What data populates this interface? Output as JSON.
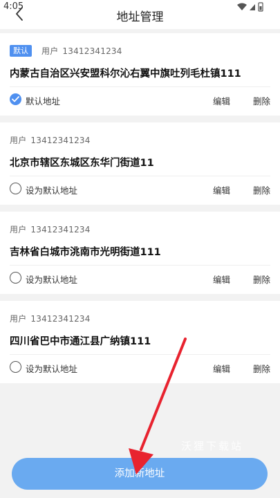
{
  "status": {
    "time": "4:05"
  },
  "header": {
    "title": "地址管理"
  },
  "addresses": [
    {
      "badge": "默认",
      "user_label": "用户",
      "phone": "13412341234",
      "address": "内蒙古自治区兴安盟科尔沁右翼中旗吐列毛杜镇111",
      "default_text": "默认地址",
      "edit": "编辑",
      "delete": "删除"
    },
    {
      "user_label": "用户",
      "phone": "13412341234",
      "address": "北京市辖区东城区东华门街道11",
      "default_text": "设为默认地址",
      "edit": "编辑",
      "delete": "删除"
    },
    {
      "user_label": "用户",
      "phone": "13412341234",
      "address": "吉林省白城市洮南市光明街道111",
      "default_text": "设为默认地址",
      "edit": "编辑",
      "delete": "删除"
    },
    {
      "user_label": "用户",
      "phone": "13412341234",
      "address": "四川省巴中市通江县广纳镇111",
      "default_text": "设为默认地址",
      "edit": "编辑",
      "delete": "删除"
    }
  ],
  "footer": {
    "add_button": "添加新地址"
  },
  "watermark": "沃狸下载站",
  "colors": {
    "accent": "#4f90f0",
    "button": "#6aaaf0",
    "arrow": "#e8232f"
  }
}
